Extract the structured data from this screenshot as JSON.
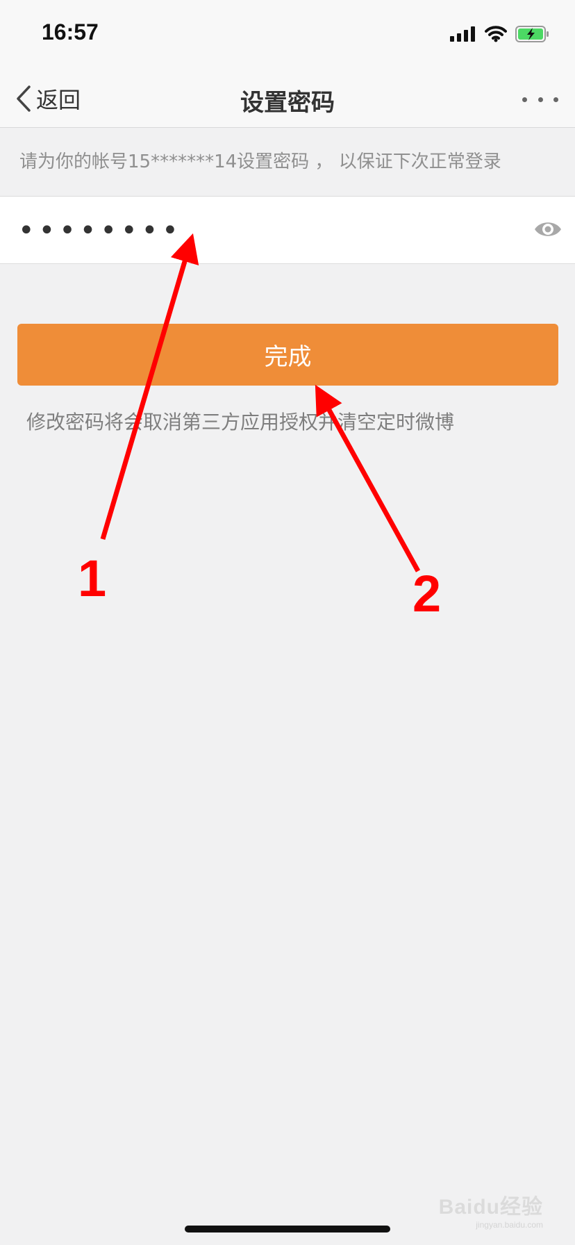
{
  "status_bar": {
    "time": "16:57",
    "icons": [
      "signal-icon",
      "wifi-icon",
      "battery-charging-icon"
    ],
    "battery_color": "#4cd964"
  },
  "nav": {
    "back_label": "返回",
    "title": "设置密码",
    "more_icon": "more-dots-icon"
  },
  "hint": "请为你的帐号15*******14设置密码 ， 以保证下次正常登录",
  "password_field": {
    "value": "••••••••",
    "toggle_icon": "eye-icon"
  },
  "done_button": {
    "label": "完成",
    "color": "#ef8d38"
  },
  "note": "修改密码将会取消第三方应用授权并清空定时微博",
  "annotations": {
    "color": "#ff0000",
    "labels": [
      "1",
      "2"
    ]
  },
  "watermark": {
    "logo_text": "Baidu经验",
    "sub_text": "jingyan.baidu.com"
  }
}
